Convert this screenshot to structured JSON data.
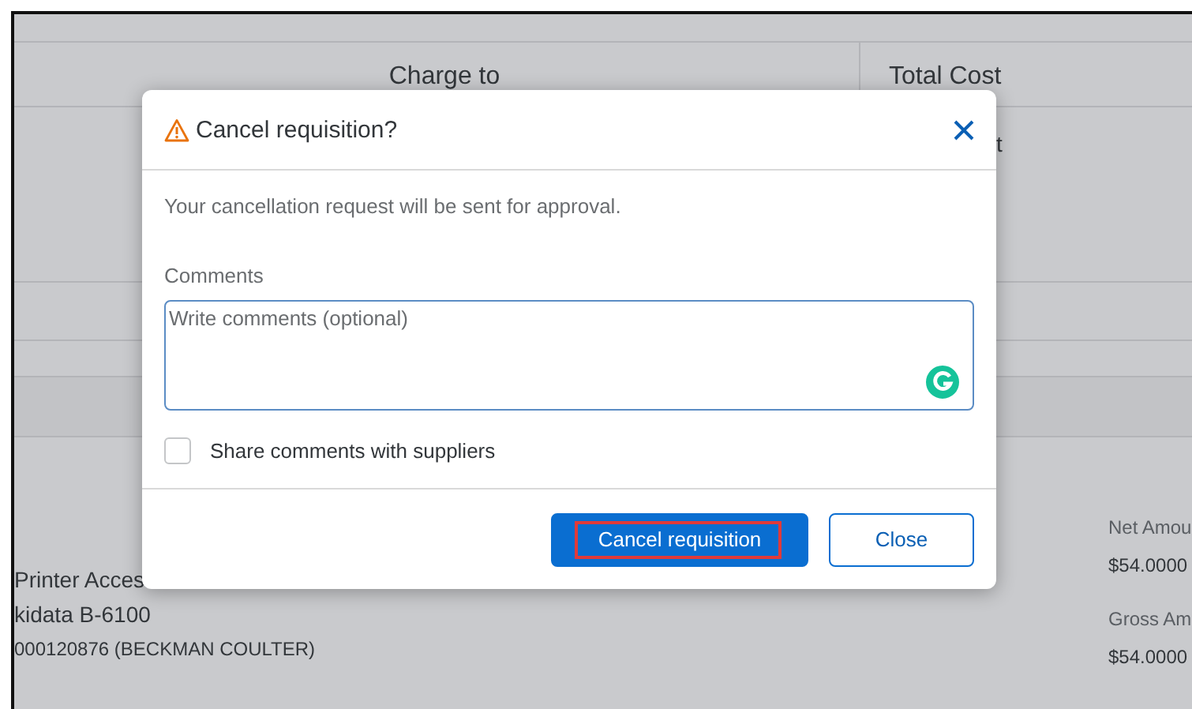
{
  "background": {
    "columns": [
      "Charge to",
      "Total Cost"
    ],
    "partial_text": "t",
    "item": {
      "lines": [
        "Printer Acces",
        "kidata B-6100",
        "000120876 (BECKMAN COULTER)"
      ]
    },
    "amounts": [
      {
        "label": "Net Amou",
        "value": "$54.0000"
      },
      {
        "label": "Gross Am",
        "value": "$54.0000"
      }
    ]
  },
  "dialog": {
    "title": "Cancel requisition?",
    "message": "Your cancellation request will be sent for approval.",
    "comments_label": "Comments",
    "comments": {
      "placeholder": "Write comments (optional)"
    },
    "share": {
      "label": "Share comments with suppliers",
      "checked": false
    },
    "buttons": [
      {
        "label": "Cancel requisition",
        "kind": "primary",
        "highlighted": true
      },
      {
        "label": "Close",
        "kind": "secondary",
        "highlighted": false
      }
    ]
  }
}
